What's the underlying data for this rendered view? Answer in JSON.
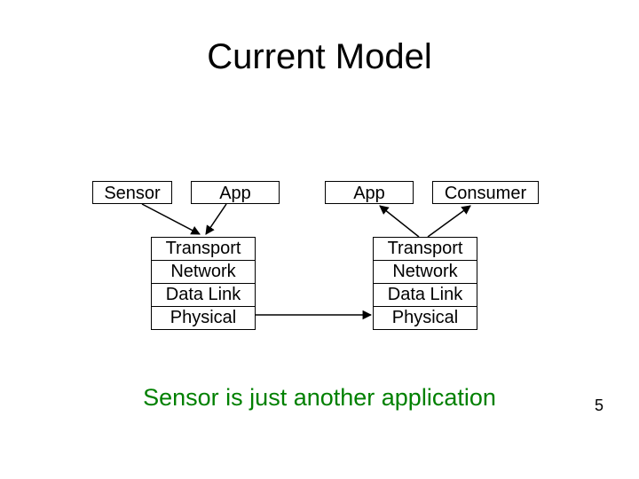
{
  "title": "Current Model",
  "top": {
    "sensor": "Sensor",
    "app_left": "App",
    "app_right": "App",
    "consumer": "Consumer"
  },
  "left_stack": {
    "l0": "Transport",
    "l1": "Network",
    "l2": "Data Link",
    "l3": "Physical"
  },
  "right_stack": {
    "l0": "Transport",
    "l1": "Network",
    "l2": "Data Link",
    "l3": "Physical"
  },
  "footer": "Sensor is just another application",
  "page_number": "5"
}
